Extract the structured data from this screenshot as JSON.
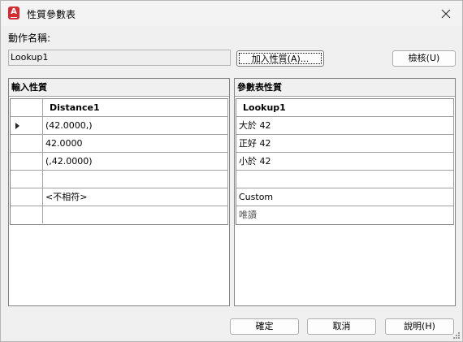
{
  "window": {
    "title": "性質參數表",
    "icon_letter": "A"
  },
  "action": {
    "label": "動作名稱:",
    "value": "Lookup1"
  },
  "buttons": {
    "add_property": "加入性質(A)...",
    "audit": "檢核(U)",
    "ok": "確定",
    "cancel": "取消",
    "help": "說明(H)"
  },
  "input_panel": {
    "title": "輸入性質",
    "column_header": "Distance1",
    "rows": [
      "(42.0000,)",
      "42.0000",
      "(,42.0000)",
      "",
      "<不相符>",
      ""
    ]
  },
  "lookup_panel": {
    "title": "參數表性質",
    "column_header": "Lookup1",
    "rows": [
      "大於 42",
      "正好 42",
      "小於 42",
      "",
      "Custom",
      "唯讀"
    ]
  },
  "colors": {
    "app_icon": "#d42a32",
    "dialog_bg": "#f0f0f0",
    "grid_line": "#a0a0a0"
  }
}
